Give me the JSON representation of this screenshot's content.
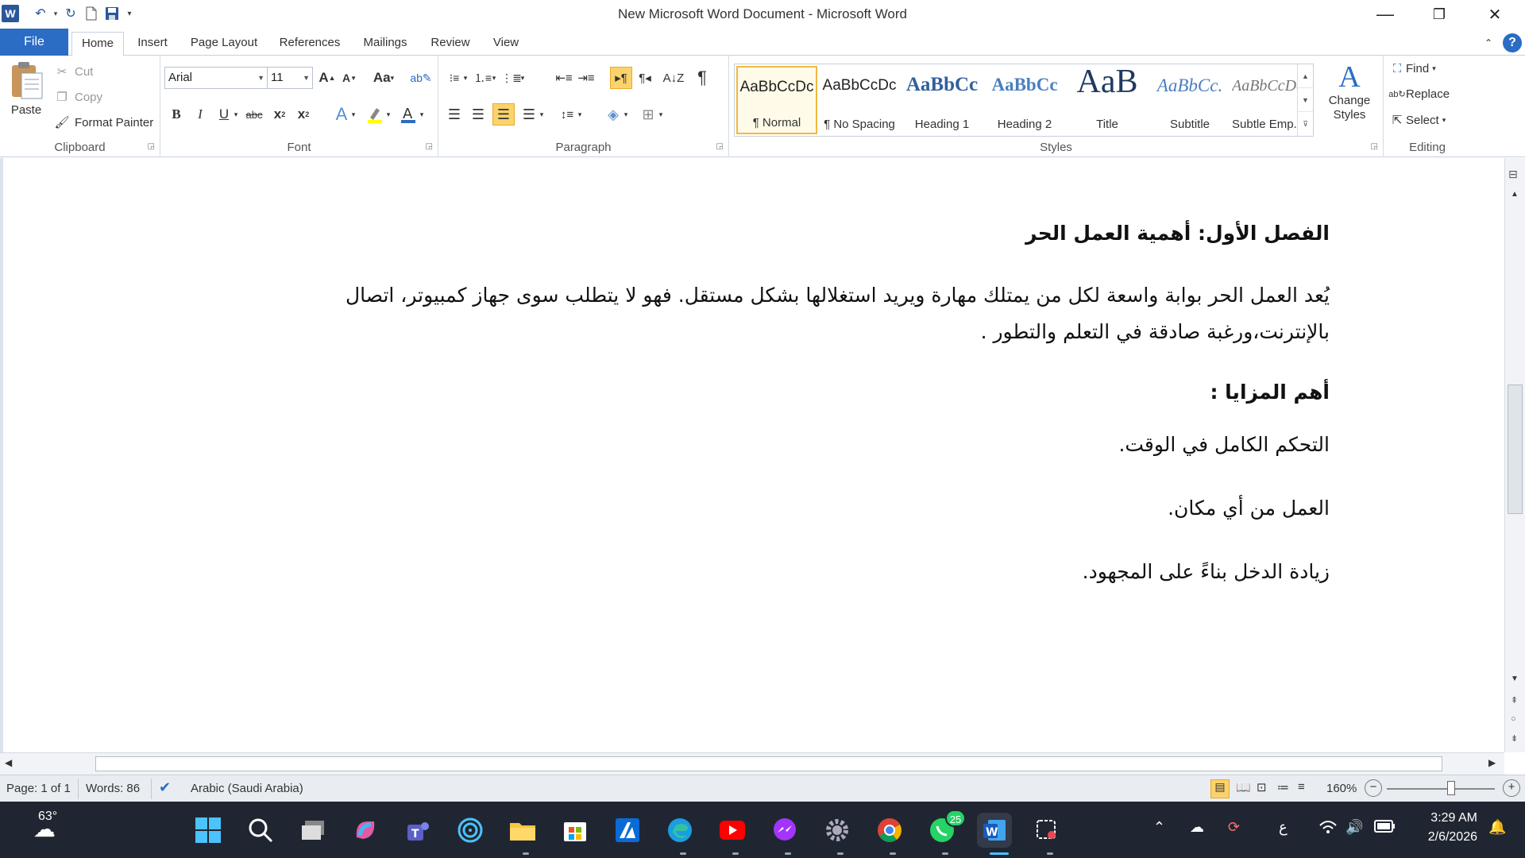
{
  "window": {
    "title": "New Microsoft Word Document - Microsoft Word",
    "minimize": "—",
    "restore": "❐",
    "close": "✕"
  },
  "tabs": [
    "File",
    "Home",
    "Insert",
    "Page Layout",
    "References",
    "Mailings",
    "Review",
    "View"
  ],
  "clipboard": {
    "label": "Clipboard",
    "paste": "Paste",
    "cut": "Cut",
    "copy": "Copy",
    "format_painter": "Format Painter"
  },
  "font": {
    "label": "Font",
    "name": "Arial",
    "size": "11"
  },
  "paragraph": {
    "label": "Paragraph"
  },
  "styles": {
    "label": "Styles",
    "change_styles": "Change Styles",
    "items": [
      {
        "sample": "AaBbCcDc",
        "name": "¶ Normal"
      },
      {
        "sample": "AaBbCcDc",
        "name": "¶ No Spacing"
      },
      {
        "sample": "AaBbCc",
        "name": "Heading 1"
      },
      {
        "sample": "AaBbCc",
        "name": "Heading 2"
      },
      {
        "sample": "AaB",
        "name": "Title"
      },
      {
        "sample": "AaBbCc.",
        "name": "Subtitle"
      },
      {
        "sample": "AaBbCcDa",
        "name": "Subtle Emp..."
      }
    ]
  },
  "editing": {
    "label": "Editing",
    "find": "Find",
    "replace": "Replace",
    "select": "Select"
  },
  "document": {
    "heading1": "الفصل الأول: أهمية العمل الحر",
    "intro_line1": "يُعد العمل الحر بوابة واسعة لكل من يمتلك مهارة ويريد استغلالها بشكل مستقل. فهو لا يتطلب سوى جهاز كمبيوتر، اتصال",
    "intro_line2": "بالإنترنت،ورغبة صادقة في التعلم والتطور .",
    "heading2": "أهم المزايا :",
    "items": [
      "التحكم الكامل في الوقت.",
      "العمل من أي مكان.",
      "زيادة الدخل بناءً على المجهود."
    ]
  },
  "status": {
    "page": "Page: 1 of 1",
    "words": "Words: 86",
    "language": "Arabic (Saudi Arabia)",
    "zoom": "160%"
  },
  "taskbar": {
    "weather_temp": "63°",
    "whatsapp_badge": "25",
    "ime": "ع",
    "time": "3:29 AM",
    "date": "2/6/2026"
  },
  "colors": {
    "accent": "#2b6cc4",
    "taskbar": "#202631",
    "highlight": "#fbd36b"
  }
}
